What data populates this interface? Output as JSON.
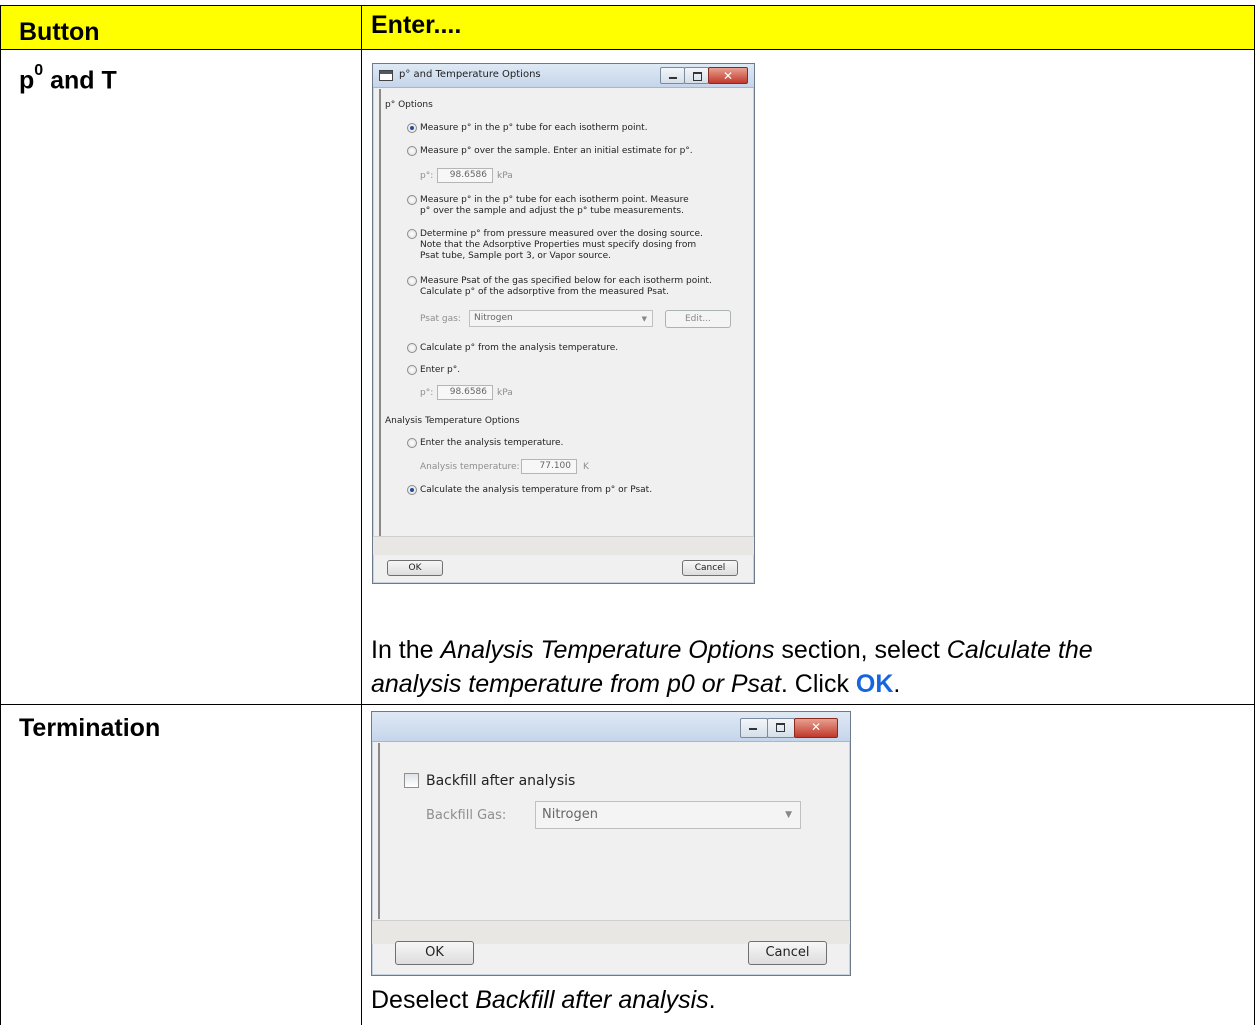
{
  "table": {
    "header": {
      "col1": "Button",
      "col2": "Enter...."
    },
    "row1": {
      "button_main": "p",
      "button_sup": "0",
      "button_rest": " and T",
      "instr_1": "In the ",
      "instr_em1": "Analysis Temperature Options",
      "instr_2": " section, select ",
      "instr_em2a": "Calculate the",
      "instr_em2b": "analysis temperature from p0 or Psat",
      "instr_3": ". Click ",
      "instr_ok": "OK",
      "instr_4": "."
    },
    "row2": {
      "button": "Termination",
      "instr_1": "Deselect ",
      "instr_em": "Backfill after analysis",
      "instr_2": "."
    }
  },
  "dialog1": {
    "title": "p° and Temperature Options",
    "section1": "p° Options",
    "options": [
      {
        "lines": [
          "Measure p° in the p° tube for each isotherm point."
        ],
        "selected": true
      },
      {
        "lines": [
          "Measure p° over the sample.  Enter an initial estimate for p°."
        ],
        "selected": false
      },
      {
        "lines": [
          "Measure p° in the p° tube for each isotherm point.  Measure",
          "p° over the sample and adjust the p° tube measurements."
        ],
        "selected": false
      },
      {
        "lines": [
          "Determine p° from pressure measured over the dosing source.",
          "Note that the Adsorptive Properties must specify dosing from",
          "Psat tube, Sample port 3, or Vapor source."
        ],
        "selected": false
      },
      {
        "lines": [
          "Measure Psat of the gas specified below for each isotherm point.",
          "Calculate p° of the adsorptive from the measured Psat."
        ],
        "selected": false
      },
      {
        "lines": [
          "Calculate p° from the analysis temperature."
        ],
        "selected": false
      },
      {
        "lines": [
          "Enter p°."
        ],
        "selected": false
      }
    ],
    "p0_field1": {
      "label": "p°:",
      "value": "98.6586",
      "unit": "kPa"
    },
    "psat_gas": {
      "label": "Psat gas:",
      "value": "Nitrogen",
      "edit_label": "Edit..."
    },
    "p0_field2": {
      "label": "p°:",
      "value": "98.6586",
      "unit": "kPa"
    },
    "section2": "Analysis Temperature Options",
    "temp_options": [
      {
        "label": "Enter the analysis temperature.",
        "selected": false
      },
      {
        "label": "Calculate the analysis temperature from p° or Psat.",
        "selected": true
      }
    ],
    "temp_field": {
      "label": "Analysis temperature:",
      "value": "77.100",
      "unit": "K"
    },
    "ok": "OK",
    "cancel": "Cancel"
  },
  "dialog2": {
    "backfill_label": "Backfill after analysis",
    "backfill_checked": false,
    "gas_label": "Backfill Gas:",
    "gas_value": "Nitrogen",
    "ok": "OK",
    "cancel": "Cancel"
  }
}
